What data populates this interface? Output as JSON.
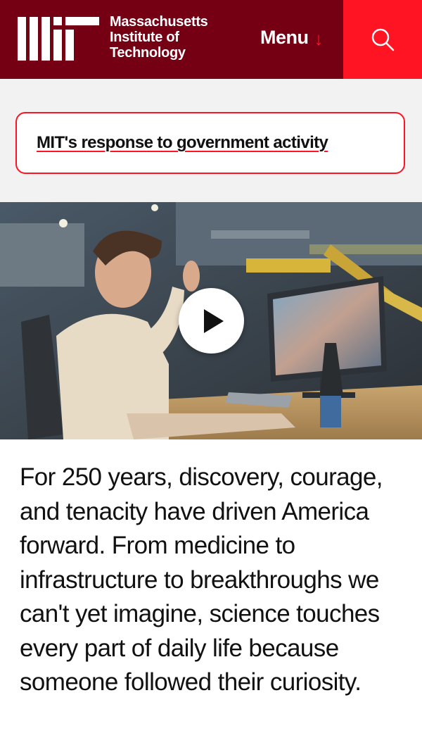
{
  "header": {
    "logo_line1": "Massachusetts",
    "logo_line2": "Institute of",
    "logo_line3": "Technology",
    "menu_label": "Menu",
    "menu_arrow": "↓",
    "search_icon": "search-icon",
    "colors": {
      "header_bg": "#750014",
      "accent": "#ff1423"
    }
  },
  "alert": {
    "link_text": "MIT's response to government activity"
  },
  "hero": {
    "play_icon": "play-icon"
  },
  "intro": {
    "text": "For 250 years, discovery, courage, and tenacity have driven America forward. From medicine to infrastructure to breakthroughs we can't yet imagine, science touches every part of daily life because someone followed their curiosity."
  }
}
